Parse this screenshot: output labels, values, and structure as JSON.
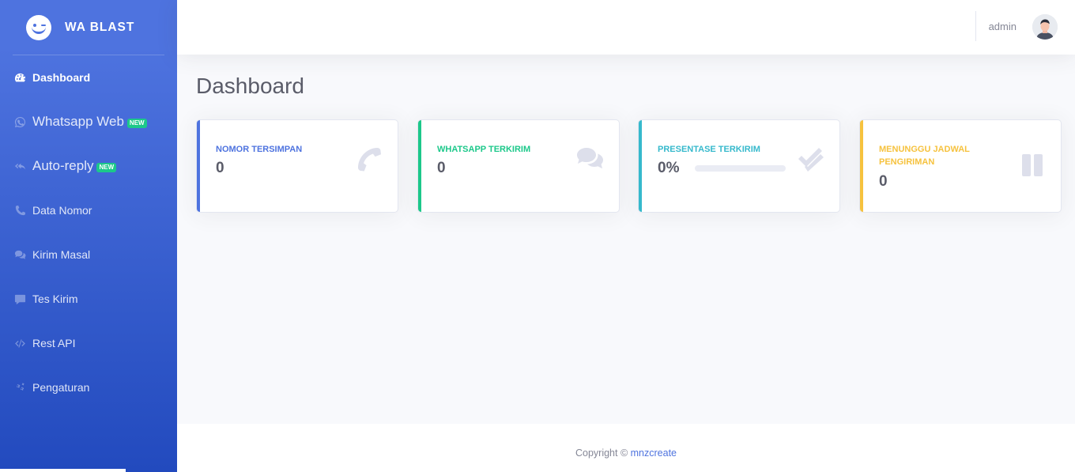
{
  "brand": {
    "name": "WA BLAST"
  },
  "sidebar": {
    "items": [
      {
        "label": "Dashboard",
        "icon": "tachometer-icon",
        "active": true
      },
      {
        "label": "Whatsapp Web",
        "icon": "whatsapp-icon",
        "badge": "NEW"
      },
      {
        "label": "Auto-reply",
        "icon": "reply-all-icon",
        "badge": "NEW"
      },
      {
        "label": "Data Nomor",
        "icon": "phone-icon"
      },
      {
        "label": "Kirim Masal",
        "icon": "comments-icon"
      },
      {
        "label": "Tes Kirim",
        "icon": "comment-icon"
      },
      {
        "label": "Rest API",
        "icon": "code-icon"
      },
      {
        "label": "Pengaturan",
        "icon": "cogs-icon"
      }
    ]
  },
  "topbar": {
    "user_name": "admin"
  },
  "page": {
    "title": "Dashboard"
  },
  "cards": [
    {
      "title": "NOMOR TERSIMPAN",
      "value": "0",
      "color": "#4e73df",
      "icon": "phone-icon"
    },
    {
      "title": "WHATSAPP TERKIRIM",
      "value": "0",
      "color": "#1cc88a",
      "icon": "comments-icon"
    },
    {
      "title": "PRESENTASE TERKIRIM",
      "value": "0%",
      "color": "#36b9cc",
      "icon": "check-double-icon",
      "progress": 0
    },
    {
      "title": "MENUNGGU JADWAL PENGIRIMAN",
      "value": "0",
      "color": "#f6c23e",
      "icon": "pause-icon"
    }
  ],
  "footer": {
    "prefix": "Copyright © ",
    "link": "mnzcreate"
  }
}
